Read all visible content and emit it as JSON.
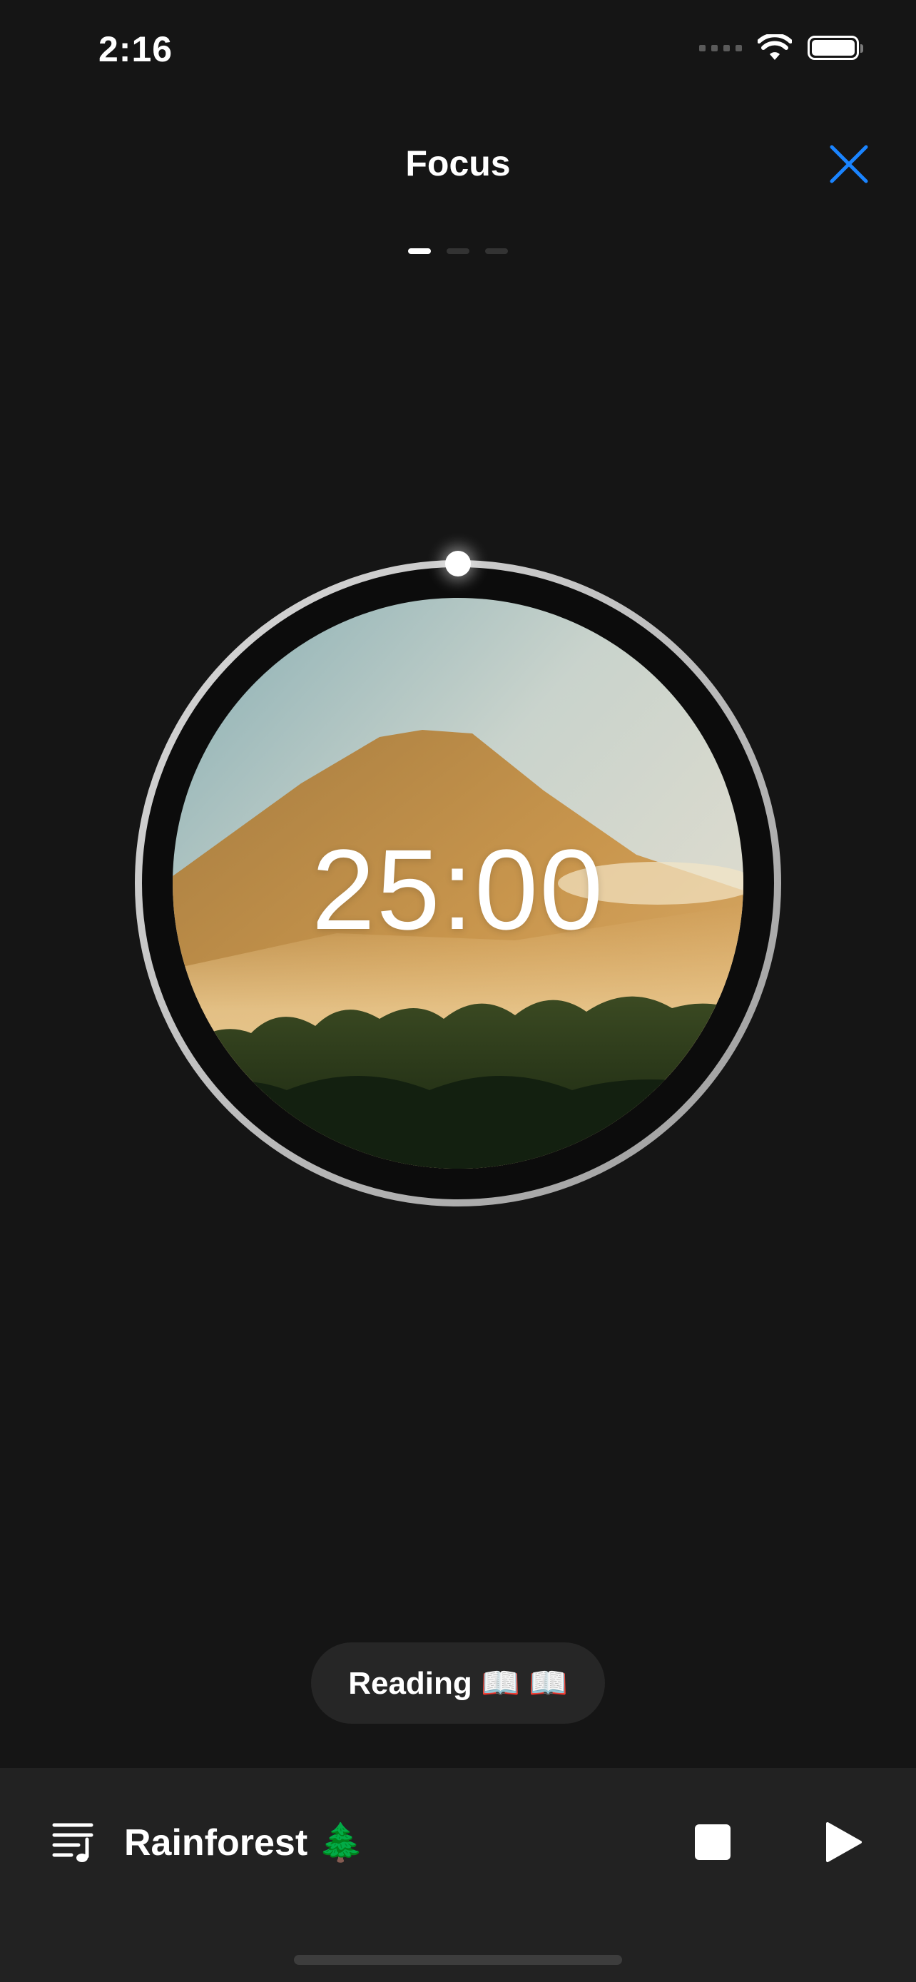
{
  "status_bar": {
    "time": "2:16"
  },
  "header": {
    "title": "Focus",
    "close_icon": "close-x-icon",
    "pages": 3,
    "active_page": 1
  },
  "timer": {
    "time": "25:00",
    "progress": 0,
    "scene": "volcano-mountain-rainforest"
  },
  "tag": {
    "label": "Reading 📖 📖"
  },
  "player": {
    "playlist_icon": "music-playlist-icon",
    "sound": "Rainforest 🌲",
    "stop_icon": "stop-icon",
    "play_icon": "play-icon"
  },
  "colors": {
    "background": "#151515",
    "accent": "#1a84ff",
    "bottom_bar": "#222222",
    "pill": "#262626"
  }
}
